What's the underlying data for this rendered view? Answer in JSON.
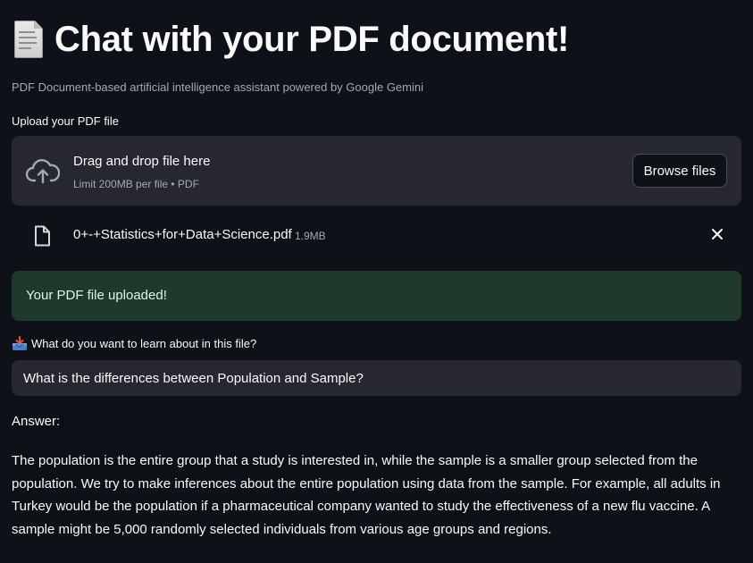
{
  "header": {
    "title": "Chat with your PDF document!",
    "title_icon": "page-facing-up-emoji",
    "subtitle": "PDF Document-based artificial intelligence assistant powered by Google Gemini"
  },
  "uploader": {
    "label": "Upload your PDF file",
    "drop_text": "Drag and drop file here",
    "limit_text": "Limit 200MB per file • PDF",
    "browse_label": "Browse files",
    "icon": "cloud-upload-icon"
  },
  "uploaded_file": {
    "name": "0+-+Statistics+for+Data+Science.pdf",
    "size": "1.9MB",
    "icon": "file-icon",
    "remove_icon": "close-icon"
  },
  "status": {
    "message": "Your PDF file uploaded!",
    "background": "#1f3a2c",
    "text_color": "#dff3e6"
  },
  "question": {
    "label": "What do you want to learn about in this file?",
    "label_icon": "inbox-tray-emoji",
    "value": "What is the differences between Population and Sample?"
  },
  "answer": {
    "label": "Answer:",
    "text": "The population is the entire group that a study is interested in, while the sample is a smaller group selected from the population. We try to make inferences about the entire population using data from the sample. For example, all adults in Turkey would be the population if a pharmaceutical company wanted to study the effectiveness of a new flu vaccine. A sample might be 5,000 randomly selected individuals from various age groups and regions."
  },
  "colors": {
    "background": "#0e1117",
    "panel": "#262730",
    "muted_text": "#a3a8b8"
  }
}
